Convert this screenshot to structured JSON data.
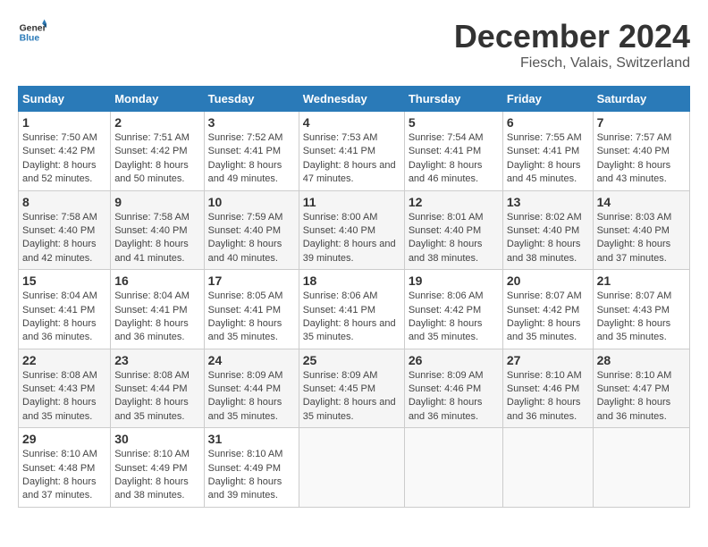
{
  "header": {
    "logo_line1": "General",
    "logo_line2": "Blue",
    "month": "December 2024",
    "location": "Fiesch, Valais, Switzerland"
  },
  "weekdays": [
    "Sunday",
    "Monday",
    "Tuesday",
    "Wednesday",
    "Thursday",
    "Friday",
    "Saturday"
  ],
  "weeks": [
    [
      {
        "day": "1",
        "sunrise": "7:50 AM",
        "sunset": "4:42 PM",
        "daylight": "8 hours and 52 minutes."
      },
      {
        "day": "2",
        "sunrise": "7:51 AM",
        "sunset": "4:42 PM",
        "daylight": "8 hours and 50 minutes."
      },
      {
        "day": "3",
        "sunrise": "7:52 AM",
        "sunset": "4:41 PM",
        "daylight": "8 hours and 49 minutes."
      },
      {
        "day": "4",
        "sunrise": "7:53 AM",
        "sunset": "4:41 PM",
        "daylight": "8 hours and 47 minutes."
      },
      {
        "day": "5",
        "sunrise": "7:54 AM",
        "sunset": "4:41 PM",
        "daylight": "8 hours and 46 minutes."
      },
      {
        "day": "6",
        "sunrise": "7:55 AM",
        "sunset": "4:41 PM",
        "daylight": "8 hours and 45 minutes."
      },
      {
        "day": "7",
        "sunrise": "7:57 AM",
        "sunset": "4:40 PM",
        "daylight": "8 hours and 43 minutes."
      }
    ],
    [
      {
        "day": "8",
        "sunrise": "7:58 AM",
        "sunset": "4:40 PM",
        "daylight": "8 hours and 42 minutes."
      },
      {
        "day": "9",
        "sunrise": "7:58 AM",
        "sunset": "4:40 PM",
        "daylight": "8 hours and 41 minutes."
      },
      {
        "day": "10",
        "sunrise": "7:59 AM",
        "sunset": "4:40 PM",
        "daylight": "8 hours and 40 minutes."
      },
      {
        "day": "11",
        "sunrise": "8:00 AM",
        "sunset": "4:40 PM",
        "daylight": "8 hours and 39 minutes."
      },
      {
        "day": "12",
        "sunrise": "8:01 AM",
        "sunset": "4:40 PM",
        "daylight": "8 hours and 38 minutes."
      },
      {
        "day": "13",
        "sunrise": "8:02 AM",
        "sunset": "4:40 PM",
        "daylight": "8 hours and 38 minutes."
      },
      {
        "day": "14",
        "sunrise": "8:03 AM",
        "sunset": "4:40 PM",
        "daylight": "8 hours and 37 minutes."
      }
    ],
    [
      {
        "day": "15",
        "sunrise": "8:04 AM",
        "sunset": "4:41 PM",
        "daylight": "8 hours and 36 minutes."
      },
      {
        "day": "16",
        "sunrise": "8:04 AM",
        "sunset": "4:41 PM",
        "daylight": "8 hours and 36 minutes."
      },
      {
        "day": "17",
        "sunrise": "8:05 AM",
        "sunset": "4:41 PM",
        "daylight": "8 hours and 35 minutes."
      },
      {
        "day": "18",
        "sunrise": "8:06 AM",
        "sunset": "4:41 PM",
        "daylight": "8 hours and 35 minutes."
      },
      {
        "day": "19",
        "sunrise": "8:06 AM",
        "sunset": "4:42 PM",
        "daylight": "8 hours and 35 minutes."
      },
      {
        "day": "20",
        "sunrise": "8:07 AM",
        "sunset": "4:42 PM",
        "daylight": "8 hours and 35 minutes."
      },
      {
        "day": "21",
        "sunrise": "8:07 AM",
        "sunset": "4:43 PM",
        "daylight": "8 hours and 35 minutes."
      }
    ],
    [
      {
        "day": "22",
        "sunrise": "8:08 AM",
        "sunset": "4:43 PM",
        "daylight": "8 hours and 35 minutes."
      },
      {
        "day": "23",
        "sunrise": "8:08 AM",
        "sunset": "4:44 PM",
        "daylight": "8 hours and 35 minutes."
      },
      {
        "day": "24",
        "sunrise": "8:09 AM",
        "sunset": "4:44 PM",
        "daylight": "8 hours and 35 minutes."
      },
      {
        "day": "25",
        "sunrise": "8:09 AM",
        "sunset": "4:45 PM",
        "daylight": "8 hours and 35 minutes."
      },
      {
        "day": "26",
        "sunrise": "8:09 AM",
        "sunset": "4:46 PM",
        "daylight": "8 hours and 36 minutes."
      },
      {
        "day": "27",
        "sunrise": "8:10 AM",
        "sunset": "4:46 PM",
        "daylight": "8 hours and 36 minutes."
      },
      {
        "day": "28",
        "sunrise": "8:10 AM",
        "sunset": "4:47 PM",
        "daylight": "8 hours and 36 minutes."
      }
    ],
    [
      {
        "day": "29",
        "sunrise": "8:10 AM",
        "sunset": "4:48 PM",
        "daylight": "8 hours and 37 minutes."
      },
      {
        "day": "30",
        "sunrise": "8:10 AM",
        "sunset": "4:49 PM",
        "daylight": "8 hours and 38 minutes."
      },
      {
        "day": "31",
        "sunrise": "8:10 AM",
        "sunset": "4:49 PM",
        "daylight": "8 hours and 39 minutes."
      },
      null,
      null,
      null,
      null
    ]
  ],
  "labels": {
    "sunrise": "Sunrise:",
    "sunset": "Sunset:",
    "daylight": "Daylight:"
  }
}
